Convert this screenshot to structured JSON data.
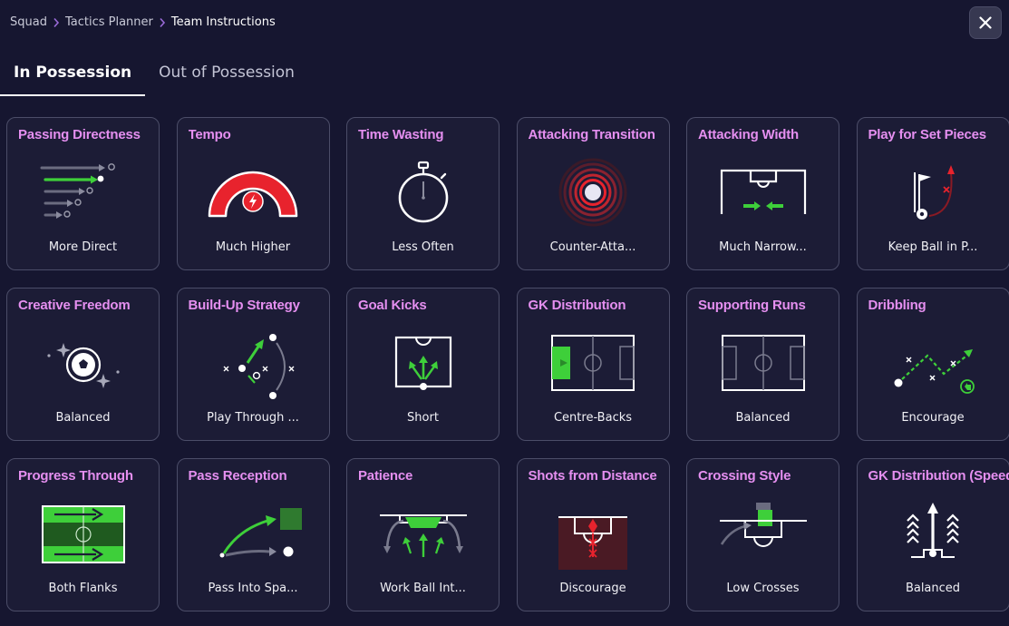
{
  "breadcrumb": [
    "Squad",
    "Tactics Planner",
    "Team Instructions"
  ],
  "tabs": [
    {
      "label": "In Possession",
      "active": true
    },
    {
      "label": "Out of Possession",
      "active": false
    }
  ],
  "colors": {
    "accent_title": "#e58ff0",
    "green": "#3ecf3a",
    "red": "#e8232d"
  },
  "cards": [
    {
      "title": "Passing Directness",
      "value": "More Direct",
      "icon": "passes-icon"
    },
    {
      "title": "Tempo",
      "value": "Much Higher",
      "icon": "tempo-gauge-icon"
    },
    {
      "title": "Time Wasting",
      "value": "Less Often",
      "icon": "stopwatch-icon"
    },
    {
      "title": "Attacking Transition",
      "value": "Counter-Atta...",
      "icon": "transition-rings-icon"
    },
    {
      "title": "Attacking Width",
      "value": "Much Narrow...",
      "icon": "width-arrows-icon"
    },
    {
      "title": "Play for Set Pieces",
      "value": "Keep Ball in P...",
      "icon": "set-piece-flag-icon"
    },
    {
      "title": "Creative Freedom",
      "value": "Balanced",
      "icon": "football-sparkle-icon"
    },
    {
      "title": "Build-Up Strategy",
      "value": "Play Through ...",
      "icon": "build-up-icon"
    },
    {
      "title": "Goal Kicks",
      "value": "Short",
      "icon": "goal-kick-icon"
    },
    {
      "title": "GK Distribution",
      "value": "Centre-Backs",
      "icon": "gk-distribution-pitch-icon"
    },
    {
      "title": "Supporting Runs",
      "value": "Balanced",
      "icon": "supporting-runs-pitch-icon"
    },
    {
      "title": "Dribbling",
      "value": "Encourage",
      "icon": "dribbling-icon"
    },
    {
      "title": "Progress Through",
      "value": "Both Flanks",
      "icon": "flanks-pitch-icon"
    },
    {
      "title": "Pass Reception",
      "value": "Pass Into Spa...",
      "icon": "pass-reception-icon"
    },
    {
      "title": "Patience",
      "value": "Work Ball Int...",
      "icon": "patience-icon"
    },
    {
      "title": "Shots from Distance",
      "value": "Discourage",
      "icon": "shots-distance-icon"
    },
    {
      "title": "Crossing Style",
      "value": "Low Crosses",
      "icon": "crossing-icon"
    },
    {
      "title": "GK Distribution (Speed",
      "value": "Balanced",
      "icon": "gk-speed-icon"
    }
  ]
}
